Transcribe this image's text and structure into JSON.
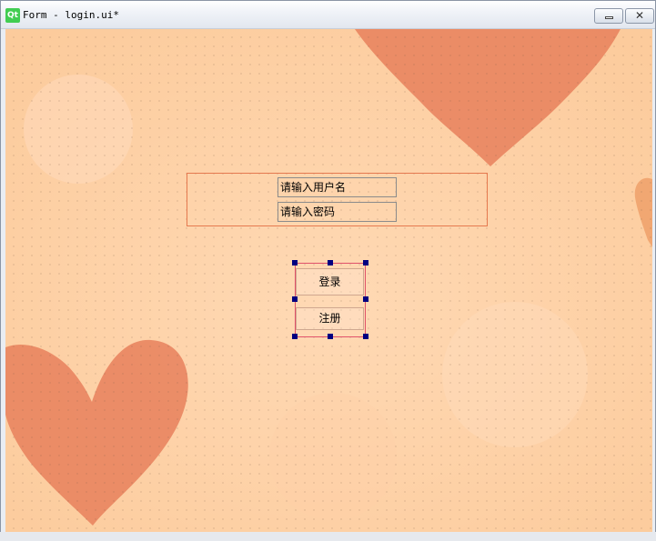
{
  "window": {
    "logo_text": "Qt",
    "title": "Form - login.ui*",
    "minimize_glyph": "",
    "close_glyph": "✕"
  },
  "form": {
    "username_placeholder": "请输入用户名",
    "password_placeholder": "请输入密码",
    "login_label": "登录",
    "register_label": "注册"
  },
  "theme": {
    "background_color": "#fdd2a6",
    "heart_color": "#e8805c",
    "group_border_color": "#e5794f",
    "handle_color": "#000080"
  }
}
